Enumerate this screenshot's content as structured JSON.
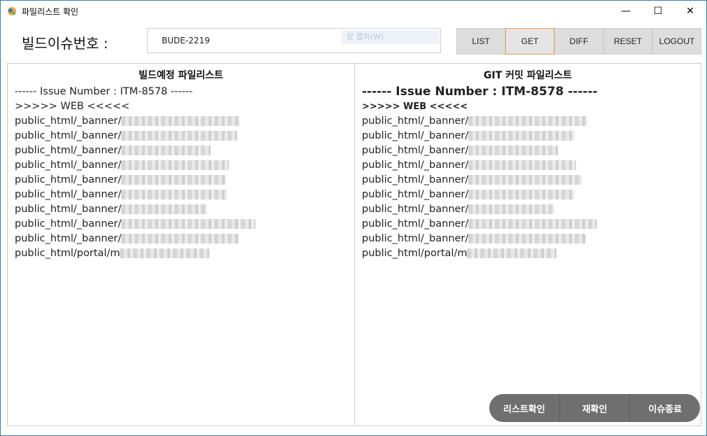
{
  "window": {
    "title": "파일리스트 확인"
  },
  "controls": {
    "minimize": "—",
    "maximize": "☐",
    "close": "✕"
  },
  "form": {
    "label": "빌드이슈번호 :",
    "issue_value": "BUDE-2219"
  },
  "ghost": {
    "text": "창 캡처(W)"
  },
  "toolbar": {
    "list": "LIST",
    "get": "GET",
    "diff": "DIFF",
    "reset": "RESET",
    "logout": "LOGOUT"
  },
  "left_panel": {
    "title": "빌드예정 파일리스트",
    "header": "------ Issue Number : ITM-8578 ------",
    "section": ">>>>> WEB <<<<<",
    "items": [
      {
        "path": "public_html/_banner/",
        "blurred": "170"
      },
      {
        "path": "public_html/_banner/",
        "blurred": "166"
      },
      {
        "path": "public_html/_banner/",
        "blurred": "128"
      },
      {
        "path": "public_html/_banner/",
        "blurred": "154"
      },
      {
        "path": "public_html/_banner/",
        "blurred": "150"
      },
      {
        "path": "public_html/_banner/",
        "blurred": "152"
      },
      {
        "path": "public_html/_banner/",
        "blurred": "122"
      },
      {
        "path": "public_html/_banner/",
        "blurred": "192"
      },
      {
        "path": "public_html/_banner/",
        "blurred": "168"
      },
      {
        "path": "public_html/portal/m",
        "blurred": "128"
      }
    ]
  },
  "right_panel": {
    "title": "GIT 커밋 파일리스트",
    "header": "------ Issue Number : ITM-8578 ------",
    "section": ">>>>> WEB <<<<<",
    "items": [
      {
        "path": "public_html/_banner/",
        "blurred": "170"
      },
      {
        "path": "public_html/_banner/",
        "blurred": "152"
      },
      {
        "path": "public_html/_banner/",
        "blurred": "128"
      },
      {
        "path": "public_html/_banner/",
        "blurred": "154"
      },
      {
        "path": "public_html/_banner/",
        "blurred": "162"
      },
      {
        "path": "public_html/_banner/",
        "blurred": "152"
      },
      {
        "path": "public_html/_banner/",
        "blurred": "122"
      },
      {
        "path": "public_html/_banner/",
        "blurred": "184"
      },
      {
        "path": "public_html/_banner/",
        "blurred": "168"
      },
      {
        "path": "public_html/portal/m",
        "blurred": "128"
      }
    ]
  },
  "actions": {
    "check_list": "리스트확인",
    "recheck": "재확인",
    "close_issue": "이슈종료"
  }
}
